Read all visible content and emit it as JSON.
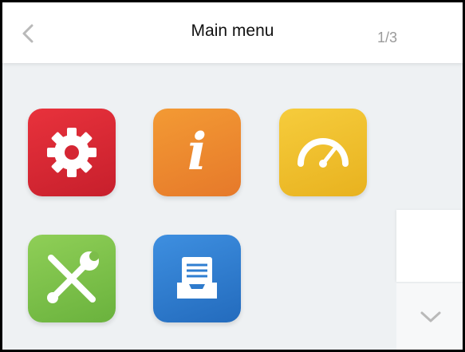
{
  "header": {
    "title": "Main menu",
    "page_indicator": "1/3",
    "back_icon": "chevron-left-icon"
  },
  "tiles": [
    {
      "icon": "gear-icon",
      "color": "#e02f3a"
    },
    {
      "icon": "info-icon",
      "glyph": "i",
      "color": "#f08a30"
    },
    {
      "icon": "gauge-icon",
      "color": "#f2c12e"
    },
    {
      "icon": "tools-icon",
      "color": "#7cc04a"
    },
    {
      "icon": "archive-tray-icon",
      "color": "#2f7ed1"
    }
  ],
  "scroll": {
    "down_icon": "chevron-down-icon"
  },
  "colors": {
    "background": "#eef1f3",
    "header": "#ffffff",
    "chevron": "#b9b9b9"
  }
}
